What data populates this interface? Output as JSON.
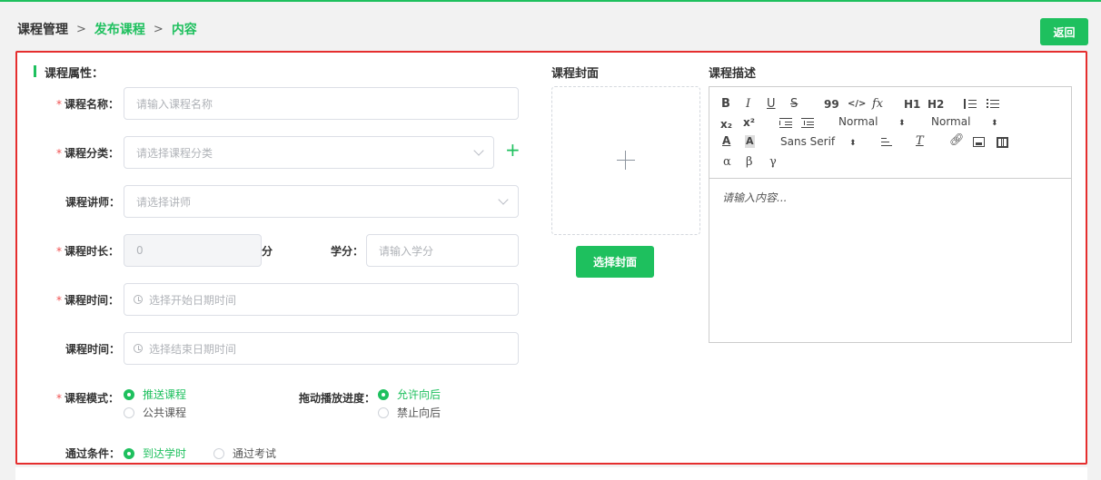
{
  "breadcrumb": {
    "items": [
      "课程管理",
      "发布课程",
      "内容"
    ]
  },
  "header": {
    "back_label": "返回"
  },
  "form": {
    "section_title": "课程属性：",
    "name": {
      "label": "课程名称：",
      "placeholder": "请输入课程名称"
    },
    "category": {
      "label": "课程分类：",
      "placeholder": "请选择课程分类"
    },
    "teacher": {
      "label": "课程讲师：",
      "placeholder": "请选择讲师"
    },
    "duration": {
      "label": "课程时长：",
      "value": "0",
      "unit": "分"
    },
    "credit": {
      "label": "学分：",
      "placeholder": "请输入学分"
    },
    "start_time": {
      "label": "课程时间：",
      "placeholder": "选择开始日期时间"
    },
    "end_time": {
      "label": "课程时间：",
      "placeholder": "选择结束日期时间"
    },
    "mode": {
      "label": "课程模式：",
      "options": [
        "推送课程",
        "公共课程"
      ],
      "selected": "推送课程"
    },
    "drag": {
      "label": "拖动播放进度：",
      "options": [
        "允许向后",
        "禁止向后"
      ],
      "selected": "允许向后"
    },
    "pass": {
      "label": "通过条件：",
      "options": [
        "到达学时",
        "通过考试"
      ],
      "selected": "到达学时"
    }
  },
  "cover": {
    "title": "课程封面",
    "button_label": "选择封面"
  },
  "description": {
    "title": "课程描述",
    "toolbar": {
      "row1": [
        "B",
        "I",
        "U",
        "S",
        "99",
        "</>",
        "fx",
        "H1",
        "H2"
      ],
      "header_select": "Normal",
      "size_select": "Normal",
      "font_select": "Sans Serif",
      "greek": [
        "α",
        "β",
        "γ"
      ]
    },
    "placeholder": "请输入内容..."
  },
  "colors": {
    "accent": "#1ec05e",
    "highlight_border": "#e52e2e",
    "required": "#f05050"
  }
}
